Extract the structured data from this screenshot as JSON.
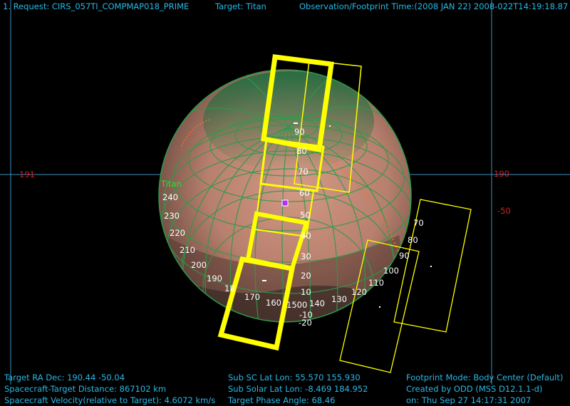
{
  "header": {
    "request": "1. Request: CIRS_057TI_COMPMAP018_PRIME",
    "target": "Target: Titan",
    "time": "Observation/Footprint Time:(2008 JAN 22) 2008-022T14:19:18.87"
  },
  "axes": {
    "left_lon": "191",
    "right_lon": "190",
    "right_lat": "-50"
  },
  "body_name": "Titan",
  "longitude_labels": [
    "240",
    "230",
    "220",
    "210",
    "200",
    "190",
    "18",
    "170",
    "160",
    "150",
    "140",
    "130",
    "120",
    "110",
    "100",
    "90",
    "80",
    "70"
  ],
  "latitude_labels": [
    "90",
    "80",
    "70",
    "60",
    "50",
    "40",
    "30",
    "20",
    "10",
    "0",
    "-10",
    "-20"
  ],
  "footer": {
    "left": [
      "Target RA Dec: 190.44  -50.04",
      "Spacecraft-Target Distance:  867102 km",
      "Spacecraft Velocity(relative to Target): 4.6072 km/s"
    ],
    "middle": [
      "Sub SC Lat Lon: 55.570  155.930",
      "Sub Solar Lat Lon: -8.469  184.952",
      "Target Phase Angle: 68.46"
    ],
    "right": [
      "Footprint Mode: Body Center (Default)",
      "Created by ODD (MSS D12.1.1-d)",
      "on: Thu Sep 27 14:17:31 2007"
    ]
  },
  "colors": {
    "text": "#29b8e6",
    "axis_label": "#cc2222",
    "footprint": "#ffff00",
    "grid": "#2e9a4a",
    "body_fill": "#c48d7a"
  }
}
